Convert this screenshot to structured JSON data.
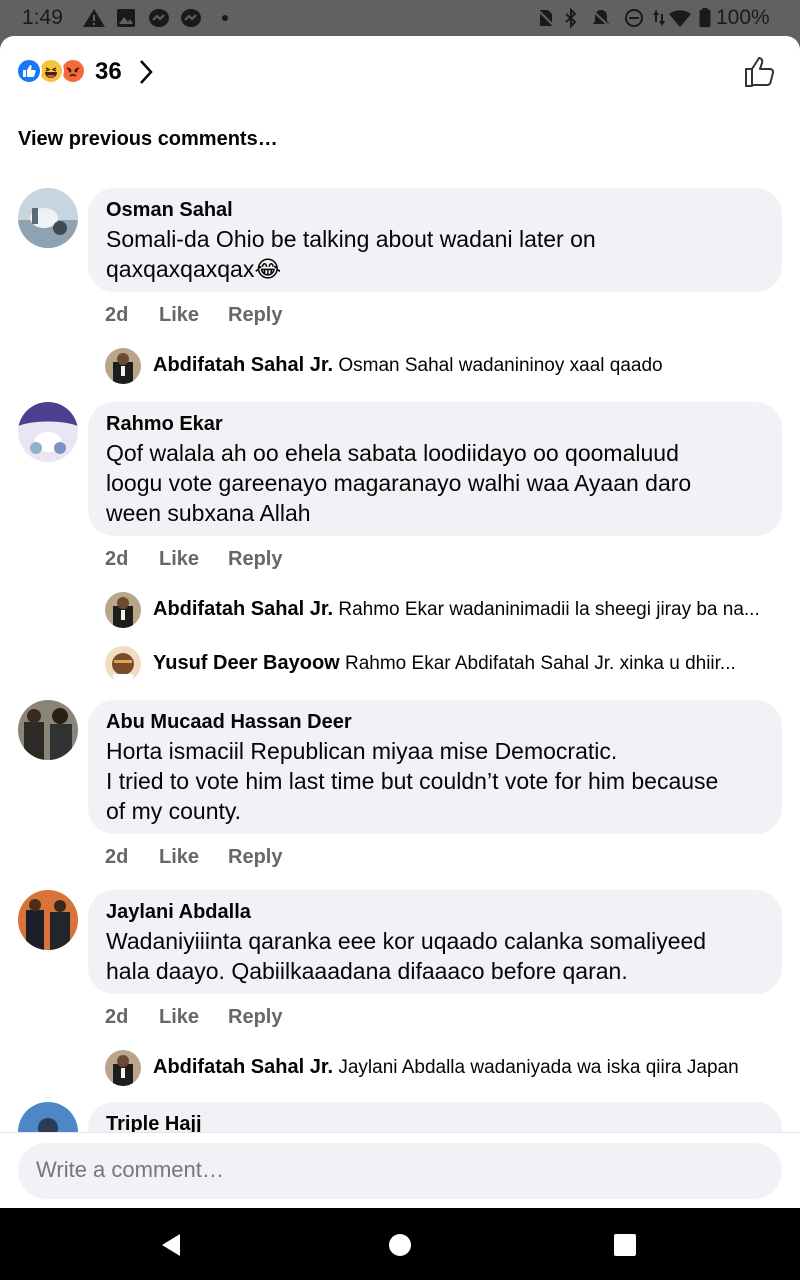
{
  "status_bar": {
    "time": "1:49",
    "battery": "100%",
    "left_icons": [
      "warning-icon",
      "image-icon",
      "messenger-icon",
      "messenger-icon",
      "dot-icon"
    ],
    "right_icons": [
      "no-sim-icon",
      "bluetooth-icon",
      "mute-icon",
      "do-not-disturb-icon",
      "data-arrows-icon",
      "wifi-icon",
      "battery-icon"
    ]
  },
  "header": {
    "reaction_icons": [
      "like-reaction-icon",
      "haha-reaction-icon",
      "angry-reaction-icon"
    ],
    "reaction_count": "36",
    "like_icon": "thumbs-up-icon"
  },
  "view_previous": "View previous comments…",
  "comments": [
    {
      "author": "Osman Sahal",
      "text": "Somali-da Ohio be talking about wadani later on\nqaxqaxqaxqax😂",
      "time": "2d",
      "like": "Like",
      "reply": "Reply",
      "replies": [
        {
          "author": "Abdifatah Sahal Jr.",
          "text": "Osman Sahal  wadanininoy xaal qaado"
        }
      ]
    },
    {
      "author": "Rahmo Ekar",
      "text": "Qof walala ah oo ehela sabata loodiidayo oo qoomaluud\nloogu vote gareenayo magaranayo walhi waa Ayaan daro\nween subxana Allah",
      "time": "2d",
      "like": "Like",
      "reply": "Reply",
      "replies": [
        {
          "author": "Abdifatah Sahal Jr.",
          "text": "Rahmo Ekar  wadaninimadii la sheegi jiray ba na..."
        },
        {
          "author": "Yusuf Deer Bayoow",
          "text": "Rahmo Ekar  Abdifatah Sahal Jr.     xinka  u dhiir..."
        }
      ]
    },
    {
      "author": "Abu Mucaad Hassan Deer",
      "text": "Horta ismaciil Republican miyaa mise Democratic.\nI tried to vote him last time but couldn’t vote for him because\nof my county.",
      "time": "2d",
      "like": "Like",
      "reply": "Reply",
      "replies": []
    },
    {
      "author": "Jaylani Abdalla",
      "text": "Wadaniyiiinta qaranka eee kor uqaado calanka somaliyeed\nhala daayo. Qabiilkaaadana difaaaco before qaran.",
      "time": "2d",
      "like": "Like",
      "reply": "Reply",
      "replies": [
        {
          "author": "Abdifatah Sahal Jr.",
          "text": "Jaylani Abdalla  wadaniyada wa iska qiira Japan"
        }
      ]
    },
    {
      "author": "Triple Hajj",
      "text": "",
      "time": "",
      "like": "",
      "reply": "",
      "replies": []
    }
  ],
  "composer": {
    "placeholder": "Write a comment…"
  },
  "nav": {
    "icons": [
      "back-icon",
      "home-icon",
      "recents-icon"
    ]
  }
}
